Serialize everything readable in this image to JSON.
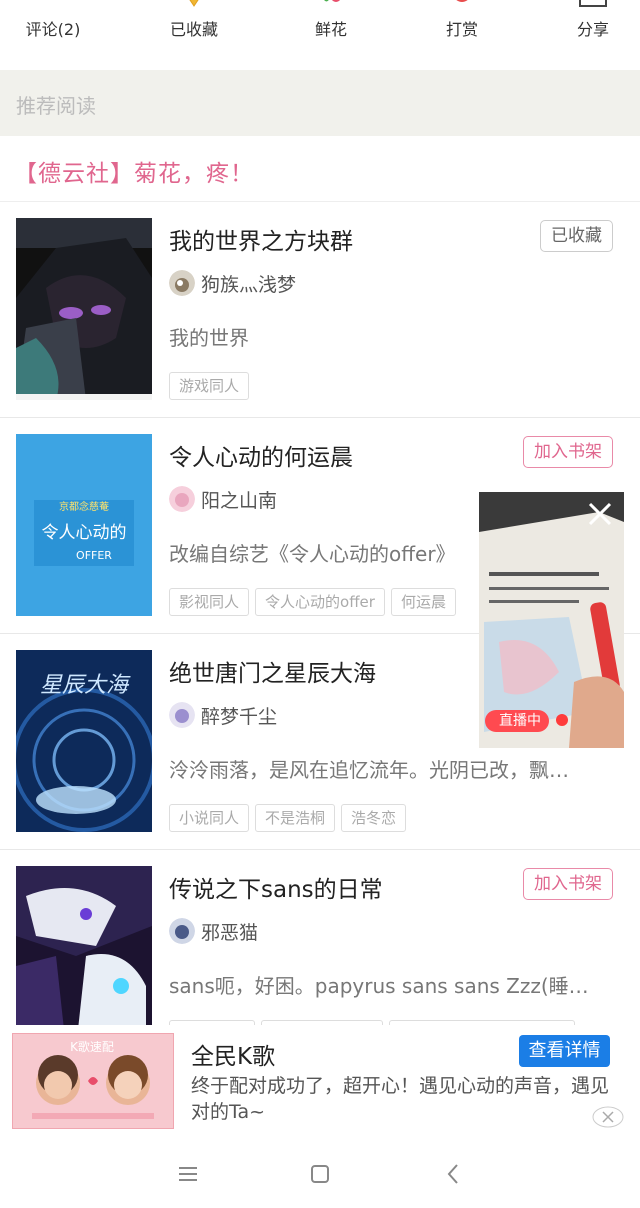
{
  "actions": [
    {
      "label": "评论(2)",
      "icon": "comment-icon"
    },
    {
      "label": "已收藏",
      "icon": "favorite-icon"
    },
    {
      "label": "鲜花",
      "icon": "flower-icon"
    },
    {
      "label": "打赏",
      "icon": "reward-icon"
    },
    {
      "label": "分享",
      "icon": "share-icon"
    }
  ],
  "recommend": {
    "header": "推荐阅读",
    "featured": "【德云社】菊花，疼！"
  },
  "books": [
    {
      "title": "我的世界之方块群",
      "author": "狗族灬浅梦",
      "desc": "我的世界",
      "tags": [
        "游戏同人"
      ],
      "shelf": "已收藏"
    },
    {
      "title": "令人心动的何运晨",
      "author": "阳之山南",
      "desc": "改编自综艺《令人心动的offer》",
      "tags": [
        "影视同人",
        "令人心动的offer",
        "何运晨"
      ],
      "shelf": "加入书架",
      "cover_text": {
        "top": "京都念慈菴",
        "mid": "令人心动的",
        "bottom": "OFFER"
      }
    },
    {
      "title": "绝世唐门之星辰大海",
      "author": "醉梦千尘",
      "desc": "泠泠雨落，是风在追忆流年。光阴已改，飘…",
      "tags": [
        "小说同人",
        "不是浩桐",
        "浩冬恋"
      ],
      "shelf": "",
      "cover_text": {
        "title": "星辰大海"
      }
    },
    {
      "title": "传说之下sans的日常",
      "author": "邪恶猫",
      "desc": "sans呃，好困。papyrus sans sans Zzz(睡…",
      "tags": [
        "",
        "",
        ""
      ],
      "shelf": "加入书架"
    }
  ],
  "live": {
    "badge": "直播中"
  },
  "ad": {
    "title": "全民K歌",
    "desc": "终于配对成功了，超开心！遇见心动的声音，遇见对的Ta~",
    "button": "查看详情",
    "banner": "K歌速配"
  },
  "colors": {
    "accent": "#e0668e",
    "ad_button": "#1b7ee6",
    "live_badge": "#ff4a50"
  }
}
